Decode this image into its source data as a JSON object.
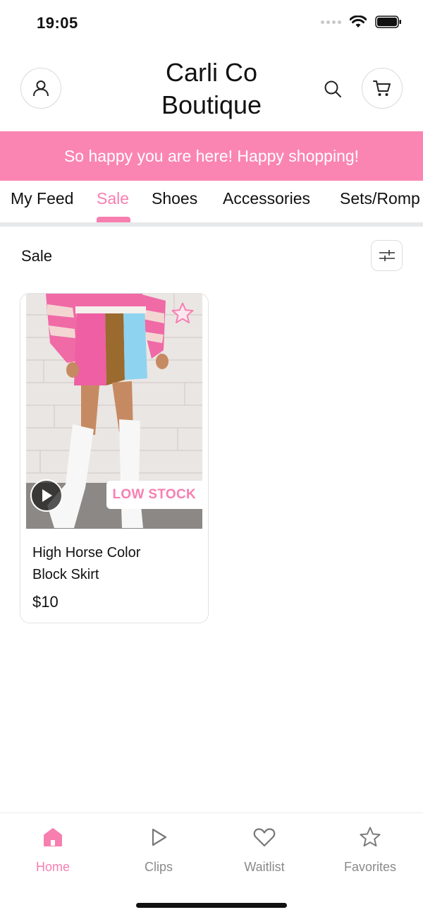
{
  "status_bar": {
    "time": "19:05"
  },
  "header": {
    "brand_line1": "Carli Co",
    "brand_line2": "Boutique"
  },
  "banner": {
    "text": "So happy you are here! Happy shopping!"
  },
  "tabs": [
    {
      "label": "My Feed"
    },
    {
      "label": "Sale"
    },
    {
      "label": "Shoes"
    },
    {
      "label": "Accessories"
    },
    {
      "label": "Sets/Romp"
    }
  ],
  "section": {
    "title": "Sale"
  },
  "products": [
    {
      "name": "High Horse Color Block Skirt",
      "price": "$10",
      "badge": "LOW STOCK"
    }
  ],
  "bottom_nav": [
    {
      "label": "Home",
      "icon": "home-icon"
    },
    {
      "label": "Clips",
      "icon": "play-icon"
    },
    {
      "label": "Waitlist",
      "icon": "heart-icon"
    },
    {
      "label": "Favorites",
      "icon": "star-icon"
    }
  ],
  "colors": {
    "accent": "#f77fb0",
    "banner": "#fa85b2"
  }
}
